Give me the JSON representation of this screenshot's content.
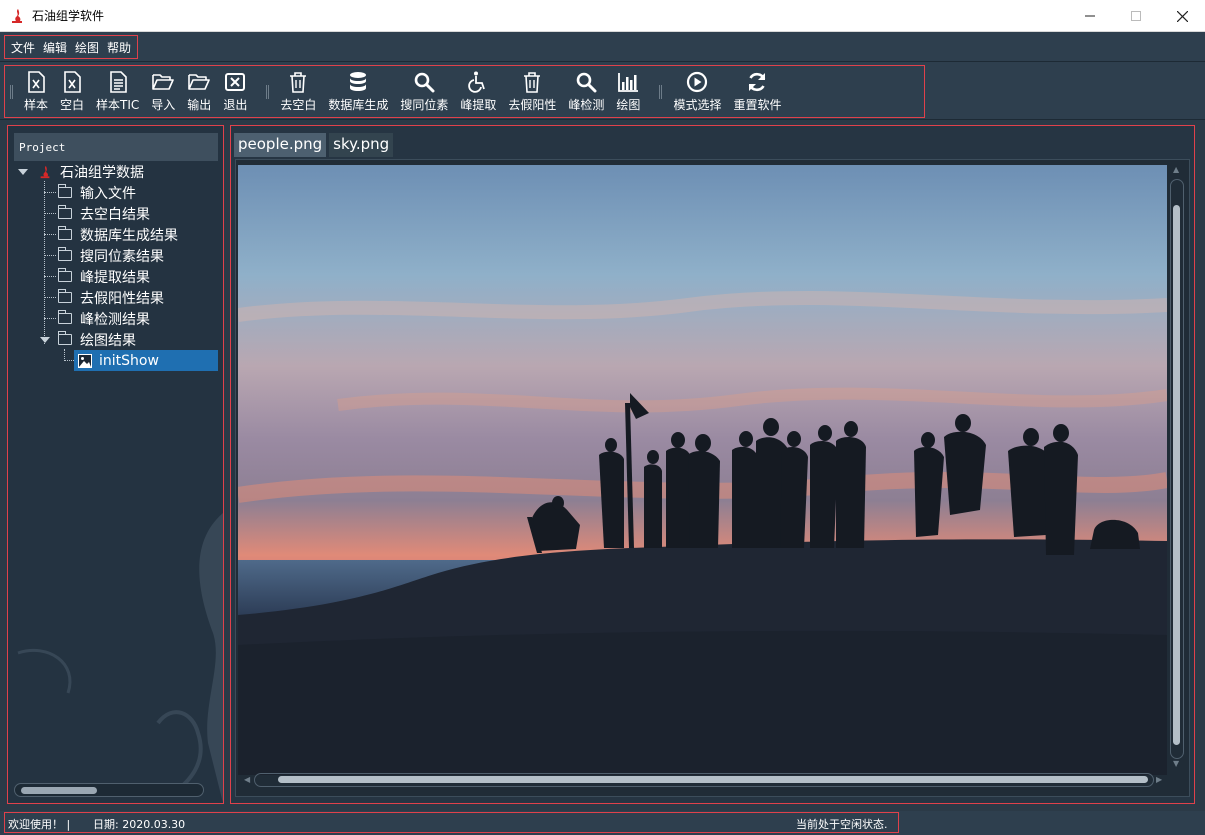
{
  "window": {
    "title": "石油组学软件"
  },
  "menu": {
    "items": [
      "文件",
      "编辑",
      "绘图",
      "帮助"
    ]
  },
  "toolbar": {
    "buttons": [
      {
        "label": "样本",
        "icon": "excel-file-icon"
      },
      {
        "label": "空白",
        "icon": "excel-file-icon"
      },
      {
        "label": "样本TIC",
        "icon": "document-icon"
      },
      {
        "label": "导入",
        "icon": "folder-open-icon"
      },
      {
        "label": "输出",
        "icon": "folder-open-icon"
      },
      {
        "label": "退出",
        "icon": "close-box-icon"
      },
      {
        "label": "去空白",
        "icon": "trash-icon"
      },
      {
        "label": "数据库生成",
        "icon": "database-icon"
      },
      {
        "label": "搜同位素",
        "icon": "search-icon"
      },
      {
        "label": "峰提取",
        "icon": "wheelchair-icon"
      },
      {
        "label": "去假阳性",
        "icon": "trash-icon"
      },
      {
        "label": "峰检测",
        "icon": "search-icon"
      },
      {
        "label": "绘图",
        "icon": "bar-chart-icon"
      },
      {
        "label": "模式选择",
        "icon": "play-circle-icon"
      },
      {
        "label": "重置软件",
        "icon": "refresh-icon"
      }
    ]
  },
  "project": {
    "header": "Project",
    "root": "石油组学数据",
    "folders": [
      "输入文件",
      "去空白结果",
      "数据库生成结果",
      "搜同位素结果",
      "峰提取结果",
      "去假阳性结果",
      "峰检测结果",
      "绘图结果"
    ],
    "selected_item": "initShow"
  },
  "tabs": [
    "people.png",
    "sky.png"
  ],
  "status": {
    "welcome": "欢迎使用！ |",
    "date": "日期: 2020.03.30",
    "state": "当前处于空闲状态."
  },
  "colors": {
    "accent_border": "#e0414b",
    "selection": "#1f6fb1",
    "background": "#2b3a47"
  }
}
